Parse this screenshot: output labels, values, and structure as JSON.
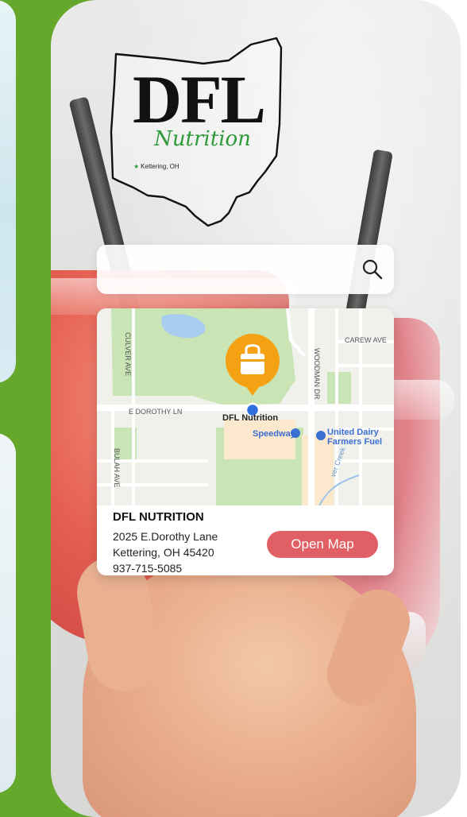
{
  "logo": {
    "brand": "DFL",
    "sub": "Nutrition",
    "location": "Kettering, OH"
  },
  "search": {
    "placeholder": "",
    "value": ""
  },
  "map": {
    "streets": [
      "CULVER AVE",
      "E DOROTHY LN",
      "WOODMAN DR",
      "CAREW AVE",
      "BULAH AVE"
    ],
    "pin_label": "DFL Nutrition",
    "poi_speedway": "Speedway",
    "poi_udf_line1": "United Dairy",
    "poi_udf_line2": "Farmers Fuel",
    "creek": "ver Creek"
  },
  "business": {
    "name": "DFL NUTRITION",
    "address_line1": "2025 E.Dorothy Lane",
    "address_line2": "Kettering, OH 45420",
    "phone": "937-715-5085",
    "button_label": "Open Map"
  },
  "colors": {
    "green_bg": "#66a82b",
    "button": "#e06065",
    "pin": "#f5a114",
    "nutrition_green": "#2e9a3a"
  }
}
